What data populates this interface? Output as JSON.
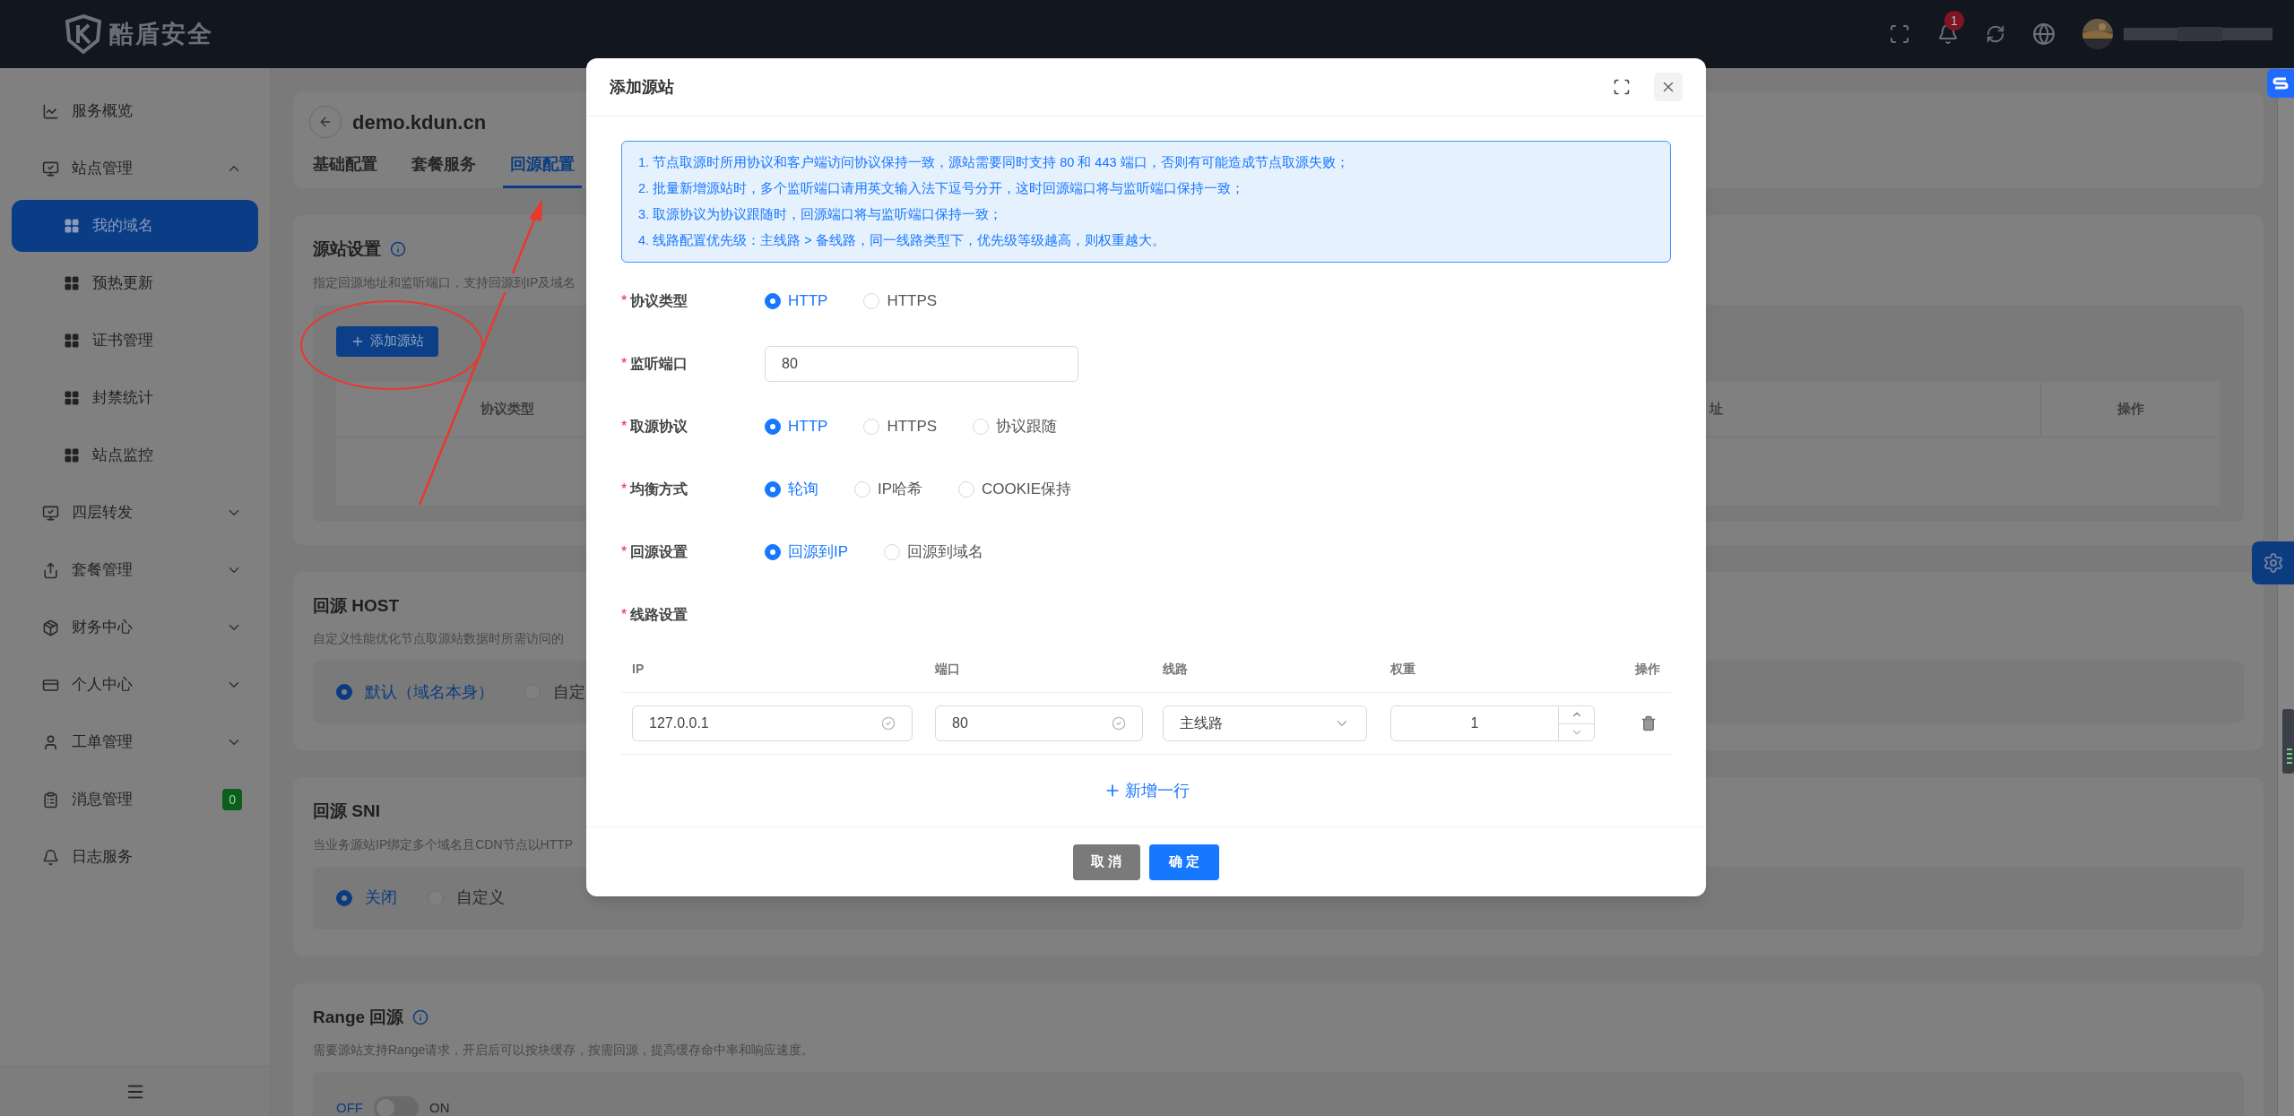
{
  "top_bar": {
    "logo_text": "酷盾安全",
    "notification_count": "1"
  },
  "sidebar": {
    "items": [
      {
        "label": "服务概览",
        "selected": false
      },
      {
        "label": "站点管理",
        "selected": false,
        "expanded": true,
        "children": [
          {
            "label": "我的域名",
            "selected": true
          },
          {
            "label": "预热更新",
            "selected": false
          },
          {
            "label": "证书管理",
            "selected": false
          },
          {
            "label": "封禁统计",
            "selected": false
          },
          {
            "label": "站点监控",
            "selected": false
          }
        ]
      },
      {
        "label": "四层转发",
        "selected": false,
        "expanded": false
      },
      {
        "label": "套餐管理",
        "selected": false,
        "expanded": false
      },
      {
        "label": "财务中心",
        "selected": false,
        "expanded": false
      },
      {
        "label": "个人中心",
        "selected": false,
        "expanded": false
      },
      {
        "label": "工单管理",
        "selected": false,
        "expanded": false
      },
      {
        "label": "消息管理",
        "selected": false,
        "badge": "0"
      },
      {
        "label": "日志服务",
        "selected": false
      }
    ]
  },
  "page": {
    "domain": "demo.kdun.cn",
    "tabs": [
      {
        "label": "基础配置",
        "selected": false
      },
      {
        "label": "套餐服务",
        "selected": false
      },
      {
        "label": "回源配置",
        "selected": true
      }
    ],
    "sections": [
      {
        "kind": "table",
        "title": "源站设置",
        "info": true,
        "description": "指定回源地址和监听端口，支持回源到IP及域名",
        "add_button": "添加源站",
        "columns": [
          "协议类型",
          "址",
          "操作"
        ]
      },
      {
        "kind": "radio",
        "title": "回源 HOST",
        "info": false,
        "description": "自定义性能优化节点取源站数据时所需访问的",
        "options": [
          {
            "label": "默认（域名本身）",
            "selected": true
          },
          {
            "label": "自定",
            "selected": false
          }
        ]
      },
      {
        "kind": "radio",
        "title": "回源 SNI",
        "info": false,
        "description": "当业务源站IP绑定多个域名且CDN节点以HTTP",
        "options": [
          {
            "label": "关闭",
            "selected": true
          },
          {
            "label": "自定义",
            "selected": false
          }
        ]
      },
      {
        "kind": "switch",
        "title": "Range 回源",
        "info": true,
        "description": "需要源站支持Range请求，开启后可以按块缓存，按需回源，提高缓存命中率和响应速度。",
        "off_label": "OFF",
        "on_label": "ON",
        "on": false
      }
    ]
  },
  "modal": {
    "title": "添加源站",
    "notice": [
      "1. 节点取源时所用协议和客户端访问协议保持一致，源站需要同时支持 80 和 443 端口，否则有可能造成节点取源失败；",
      "2. 批量新增源站时，多个监听端口请用英文输入法下逗号分开，这时回源端口将与监听端口保持一致；",
      "3. 取源协议为协议跟随时，回源端口将与监听端口保持一致；",
      "4. 线路配置优先级：主线路 > 备线路，同一线路类型下，优先级等级越高，则权重越大。"
    ],
    "fields": [
      {
        "kind": "radio",
        "label": "协议类型",
        "required_mark": "*",
        "options": [
          {
            "label": "HTTP",
            "selected": true
          },
          {
            "label": "HTTPS",
            "selected": false
          }
        ]
      },
      {
        "kind": "input",
        "label": "监听端口",
        "required_mark": "*",
        "value": "80"
      },
      {
        "kind": "radio",
        "label": "取源协议",
        "required_mark": "*",
        "options": [
          {
            "label": "HTTP",
            "selected": true
          },
          {
            "label": "HTTPS",
            "selected": false
          },
          {
            "label": "协议跟随",
            "selected": false
          }
        ]
      },
      {
        "kind": "radio",
        "label": "均衡方式",
        "required_mark": "*",
        "options": [
          {
            "label": "轮询",
            "selected": true
          },
          {
            "label": "IP哈希",
            "selected": false
          },
          {
            "label": "COOKIE保持",
            "selected": false
          }
        ]
      },
      {
        "kind": "radio",
        "label": "回源设置",
        "required_mark": "*",
        "options": [
          {
            "label": "回源到IP",
            "selected": true
          },
          {
            "label": "回源到域名",
            "selected": false
          }
        ]
      },
      {
        "kind": "lines",
        "label": "线路设置",
        "required_mark": "*",
        "columns": [
          "IP",
          "端口",
          "线路",
          "权重",
          "操作"
        ],
        "rows": [
          {
            "ip": "127.0.0.1",
            "port": "80",
            "line": "主线路",
            "weight": "1"
          }
        ],
        "add_row": "新增一行"
      }
    ],
    "buttons": [
      {
        "label": "取 消",
        "kind": "secondary"
      },
      {
        "label": "确 定",
        "kind": "primary"
      }
    ]
  }
}
